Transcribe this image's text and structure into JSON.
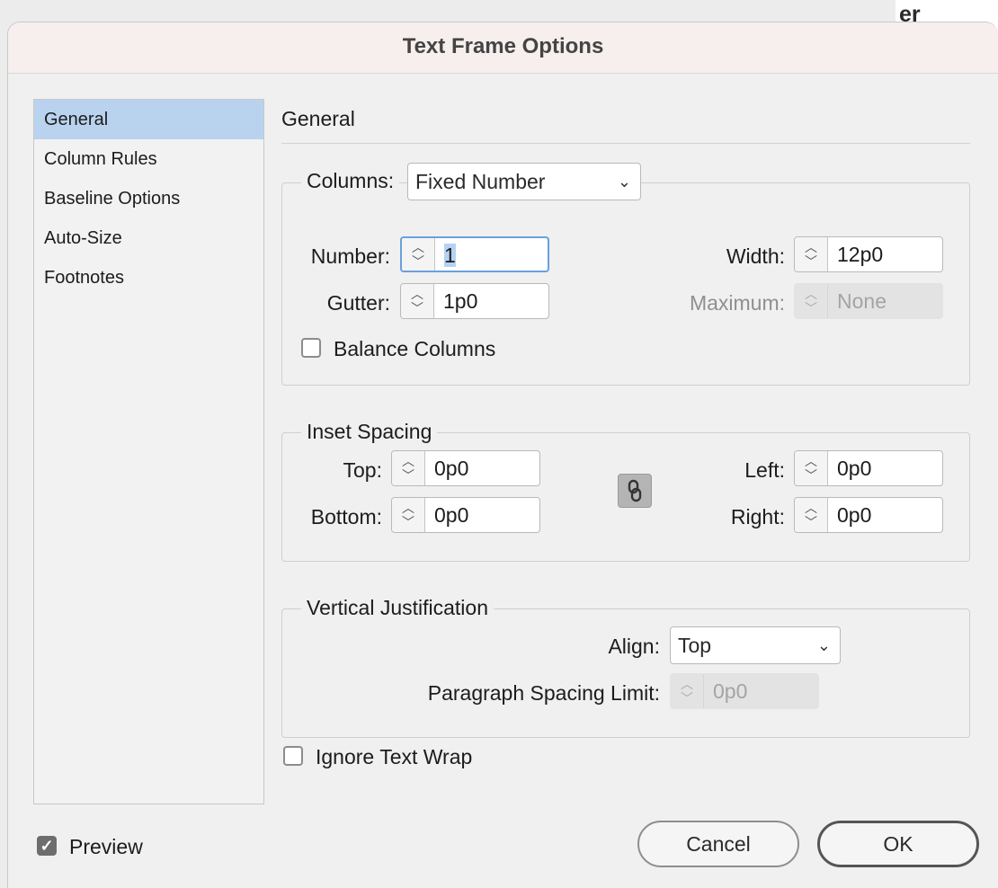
{
  "background_window": {
    "text": "er"
  },
  "dialog": {
    "title": "Text Frame Options"
  },
  "sidebar": {
    "items": [
      {
        "label": "General",
        "selected": true
      },
      {
        "label": "Column Rules",
        "selected": false
      },
      {
        "label": "Baseline Options",
        "selected": false
      },
      {
        "label": "Auto-Size",
        "selected": false
      },
      {
        "label": "Footnotes",
        "selected": false
      }
    ]
  },
  "panel": {
    "title": "General"
  },
  "columns": {
    "label": "Columns:",
    "mode": "Fixed Number",
    "number_label": "Number:",
    "number_value": "1",
    "gutter_label": "Gutter:",
    "gutter_value": "1p0",
    "width_label": "Width:",
    "width_value": "12p0",
    "maximum_label": "Maximum:",
    "maximum_value": "None",
    "balance_label": "Balance Columns",
    "balance_checked": false
  },
  "inset": {
    "legend": "Inset Spacing",
    "top_label": "Top:",
    "top_value": "0p0",
    "bottom_label": "Bottom:",
    "bottom_value": "0p0",
    "left_label": "Left:",
    "left_value": "0p0",
    "right_label": "Right:",
    "right_value": "0p0",
    "link_icon": "chain-link-icon"
  },
  "vertical": {
    "legend": "Vertical Justification",
    "align_label": "Align:",
    "align_value": "Top",
    "psl_label": "Paragraph Spacing Limit:",
    "psl_value": "0p0"
  },
  "ignore_wrap": {
    "label": "Ignore Text Wrap",
    "checked": false
  },
  "preview": {
    "label": "Preview",
    "checked": true
  },
  "buttons": {
    "cancel": "Cancel",
    "ok": "OK"
  }
}
